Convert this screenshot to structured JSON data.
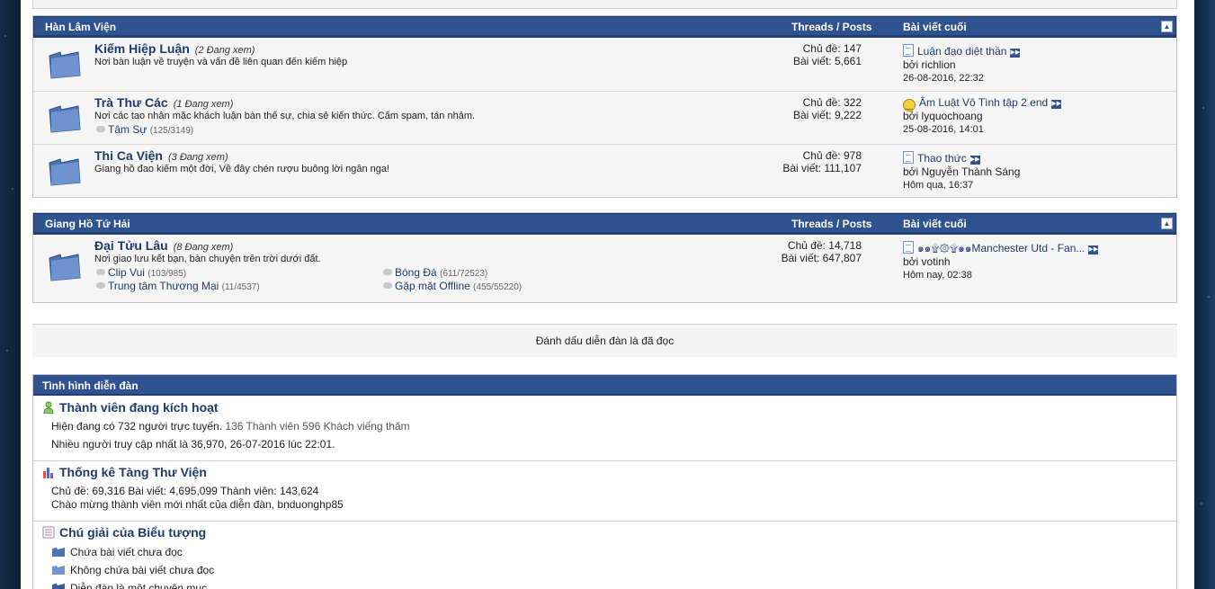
{
  "categories": [
    {
      "title": "Hàn Lâm Viện",
      "threads_posts_header": "Threads / Posts",
      "last_post_header": "Bài viết cuối",
      "collapse_icon": "collapse-icon",
      "forums": [
        {
          "name": "Kiếm Hiệp Luận",
          "viewing": "(2 Đang xem)",
          "description": "Nơi bàn luận về truyện và vấn đề liên quan đến kiếm hiệp",
          "threads": "Chủ đề: 147",
          "posts": "Bài viết: 5,661",
          "last_title": "Luận đạo diệt thần",
          "last_by": "bởi richlion",
          "last_date": "26-08-2016, 22:32"
        },
        {
          "name": "Trà Thư Các",
          "viewing": "(1 Đang xem)",
          "description": "Nơi các tao nhân mặc khách luận bàn thế sự, chia sẻ kiến thức. Cấm spam, tán nhảm.",
          "subforum_name": "Tâm Sự",
          "subforum_count": "(125/3149)",
          "threads": "Chủ đề: 322",
          "posts": "Bài viết: 9,222",
          "last_title": "Âm Luật Vô Tình tập 2 end",
          "last_by": "bởi lyquochoang",
          "last_date": "25-08-2016, 14:01"
        },
        {
          "name": "Thi Ca Viện",
          "viewing": "(3 Đang xem)",
          "description": "Giang hồ đao kiếm một đời, Về đây chén rượu buông lời ngân nga!",
          "threads": "Chủ đề: 978",
          "posts": "Bài viết: 111,107",
          "last_title": "Thao thức",
          "last_by": "bởi Nguyễn Thành Sáng",
          "last_date": "Hôm qua, 16:37"
        }
      ]
    },
    {
      "title": "Giang Hồ Tứ Hải",
      "threads_posts_header": "Threads / Posts",
      "last_post_header": "Bài viết cuối",
      "forums": [
        {
          "name": "Đại Tửu Lâu",
          "viewing": "(8 Đang xem)",
          "description": "Nơi giao lưu kết bạn, bàn chuyện trên trời dưới đất.",
          "subforums": [
            {
              "name": "Clip Vui",
              "count": "(103/985)"
            },
            {
              "name": "Bóng Đá",
              "count": "(611/72523)"
            },
            {
              "name": "Trung tâm Thương Mại",
              "count": "(11/4537)"
            },
            {
              "name": "Gặp mặt Offline",
              "count": "(455/55220)"
            }
          ],
          "threads": "Chủ đề: 14,718",
          "posts": "Bài viết: 647,807",
          "last_title": "๑๑۩۞۩๑๑Manchester Utd - Fan...",
          "last_by": "bởi votinh",
          "last_date": "Hôm nay, 02:38"
        }
      ]
    }
  ],
  "mark_read": "Đánh dấu diễn đàn là đã đọc",
  "forum_status": {
    "title": "Tình hình diễn đàn",
    "active_users_title": "Thành viên đang kích hoạt",
    "online_line_prefix": "Hiện đang có 732 người trực tuyến.",
    "online_line_suffix": "136 Thành viên 596 Khách viếng thăm",
    "record_line": "Nhiều người truy cập nhất là 36,970, 26-07-2016 lúc 22:01.",
    "stats_title": "Thống kê Tàng Thư Viện",
    "stats_line": "Chủ đề: 69,316   Bài viết: 4,695,099   Thành viên: 143,624",
    "welcome_line": "Chào mừng thành viên mới nhất của diễn đàn, bnduonghp85",
    "legend_title": "Chú giải của Biểu tượng",
    "legend_items": [
      "Chứa bài viết chưa đọc",
      "Không chứa bài viết chưa đọc",
      "Diễn đàn là một chuyên mục"
    ]
  },
  "colors": {
    "header_blue": "#2f5290",
    "link_blue": "#1d3b6e",
    "row_bg": "#f5f5f5"
  }
}
